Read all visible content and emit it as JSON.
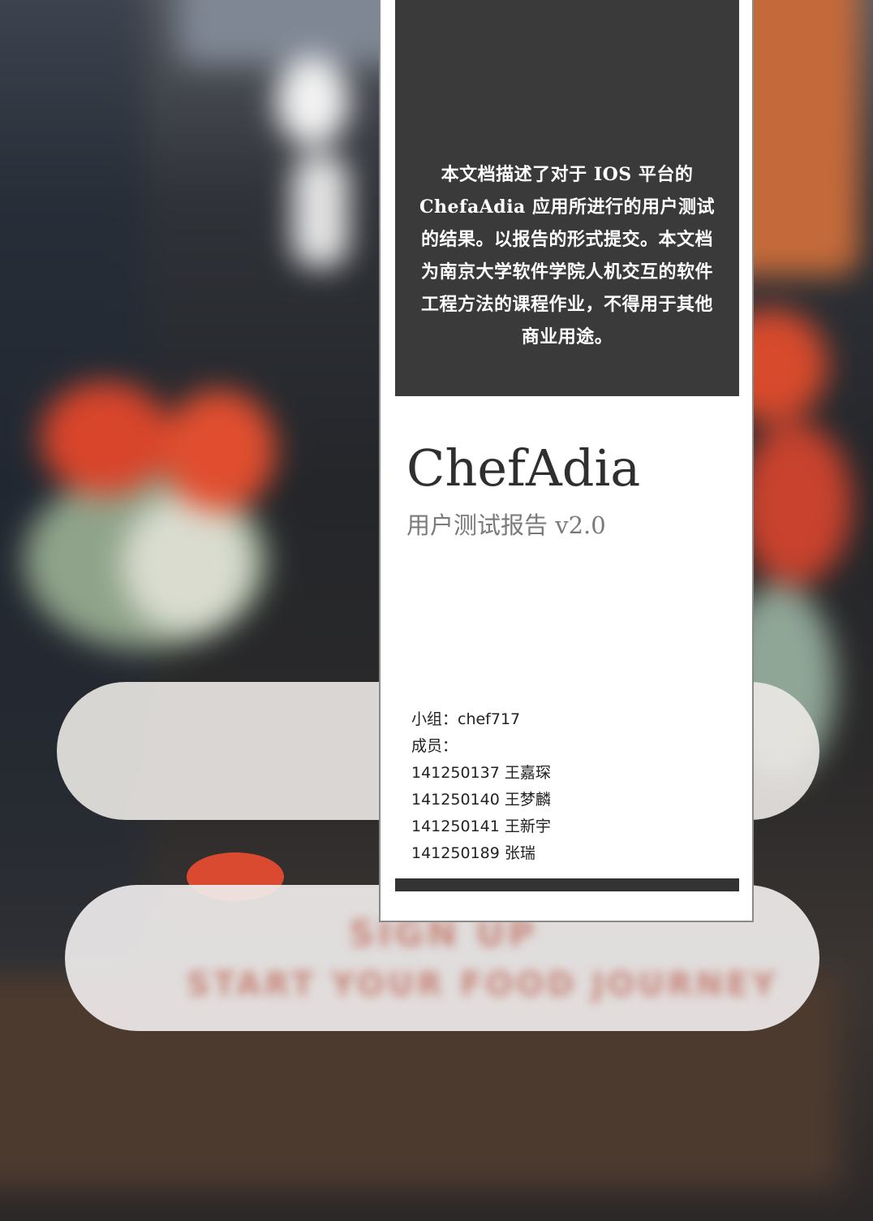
{
  "description": "本文档描述了对于 IOS 平台的 ChefaAdia 应用所进行的用户测试的结果。以报告的形式提交。本文档为南京大学软件学院人机交互的软件工程方法的课程作业，不得用于其他商业用途。",
  "title": "ChefAdia",
  "subtitle": "用户测试报告 v2.0",
  "team_line": "小组：chef717",
  "members_label": "成员：",
  "members": [
    "141250137 王嘉琛",
    "141250140 王梦麟",
    "141250141 王新宇",
    "141250189 张瑞"
  ],
  "background_faint_text": [
    "SIGN UP",
    "START YOUR FOOD JOURNEY"
  ],
  "colors": {
    "dark_box": "#3a3a3a",
    "card": "#ffffff",
    "title": "#2f2f2f",
    "subtitle": "#7a7a7a"
  }
}
